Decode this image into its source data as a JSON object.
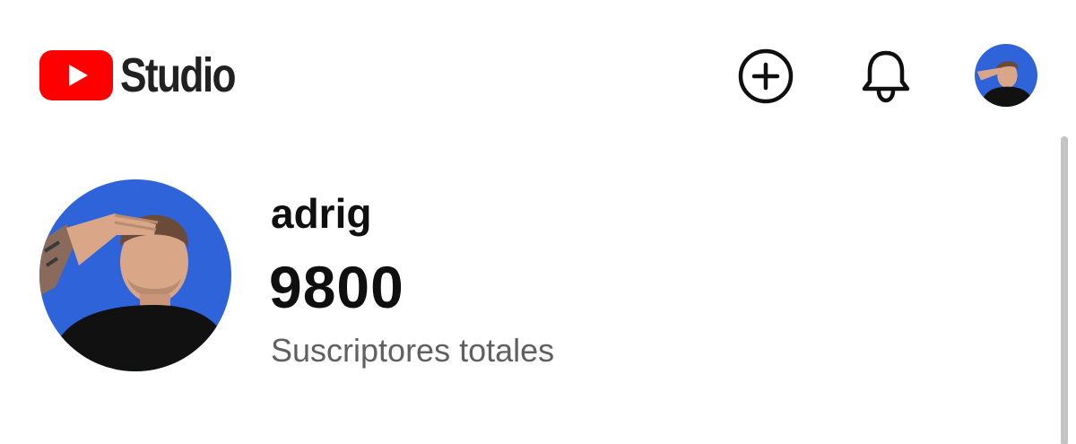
{
  "header": {
    "brand": "Studio",
    "icons": {
      "logo": "youtube-play-icon",
      "create": "add-circle-icon",
      "notifications": "bell-icon",
      "account": "avatar"
    }
  },
  "channel": {
    "name": "adrig",
    "subscriber_count": "9800",
    "subscriber_label": "Suscriptores totales"
  },
  "colors": {
    "brand_red": "#ff0000",
    "avatar_background": "#2f63d9",
    "text_primary": "#0f0f0f",
    "text_secondary": "#606060"
  }
}
